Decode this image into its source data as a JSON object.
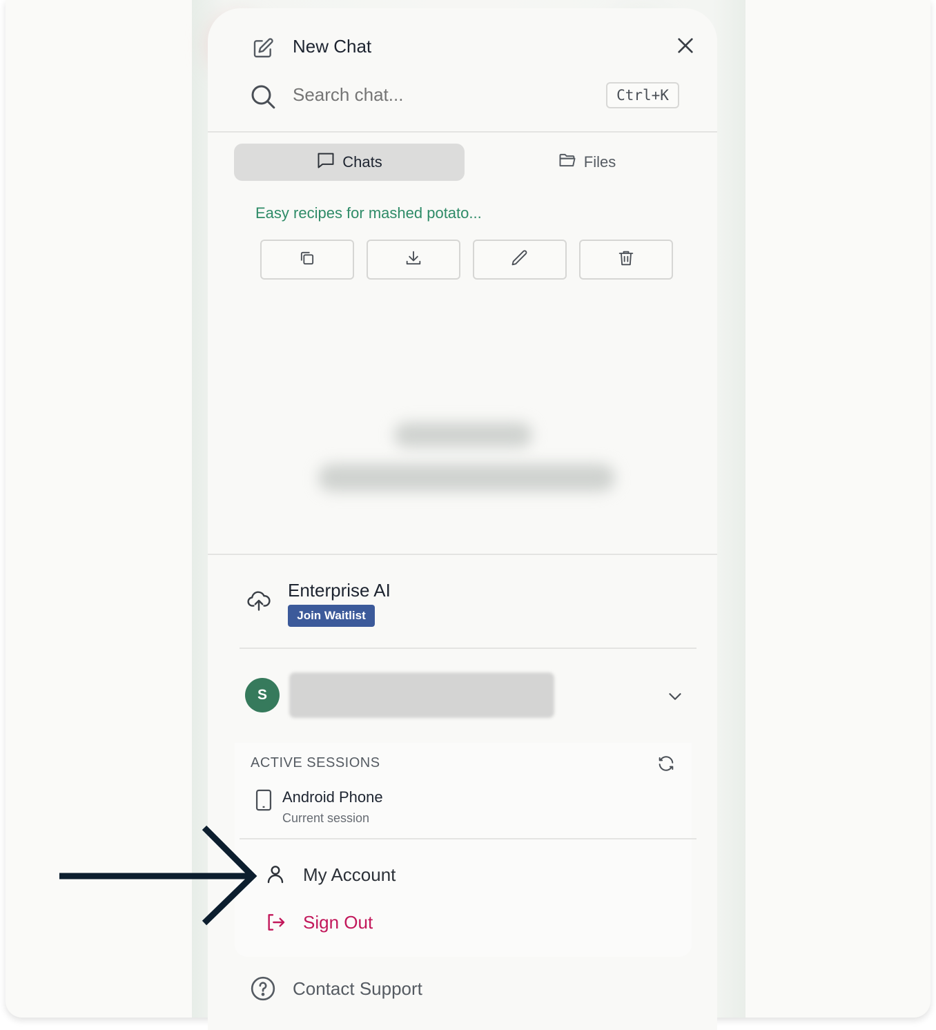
{
  "header": {
    "new_chat_label": "New Chat",
    "search_placeholder": "Search chat...",
    "shortcut": "Ctrl+K"
  },
  "tabs": [
    {
      "label": "Chats",
      "active": true
    },
    {
      "label": "Files",
      "active": false
    }
  ],
  "recent_chat": {
    "title": "Easy recipes for mashed potato...",
    "actions": [
      "copy-icon",
      "download-icon",
      "pencil-icon",
      "trash-icon"
    ]
  },
  "enterprise": {
    "title": "Enterprise AI",
    "badge": "Join Waitlist"
  },
  "account": {
    "avatar_initial": "S"
  },
  "sessions": {
    "heading": "ACTIVE SESSIONS",
    "device_name": "Android Phone",
    "device_status": "Current session"
  },
  "menu": {
    "my_account": "My Account",
    "sign_out": "Sign Out",
    "contact_support": "Contact Support"
  },
  "colors": {
    "accent_green": "#2e8b67",
    "avatar_green": "#367a5c",
    "waitlist_blue": "#3c5a9a",
    "sign_out_red": "#c2185b",
    "arrow_navy": "#0c1e2e"
  }
}
